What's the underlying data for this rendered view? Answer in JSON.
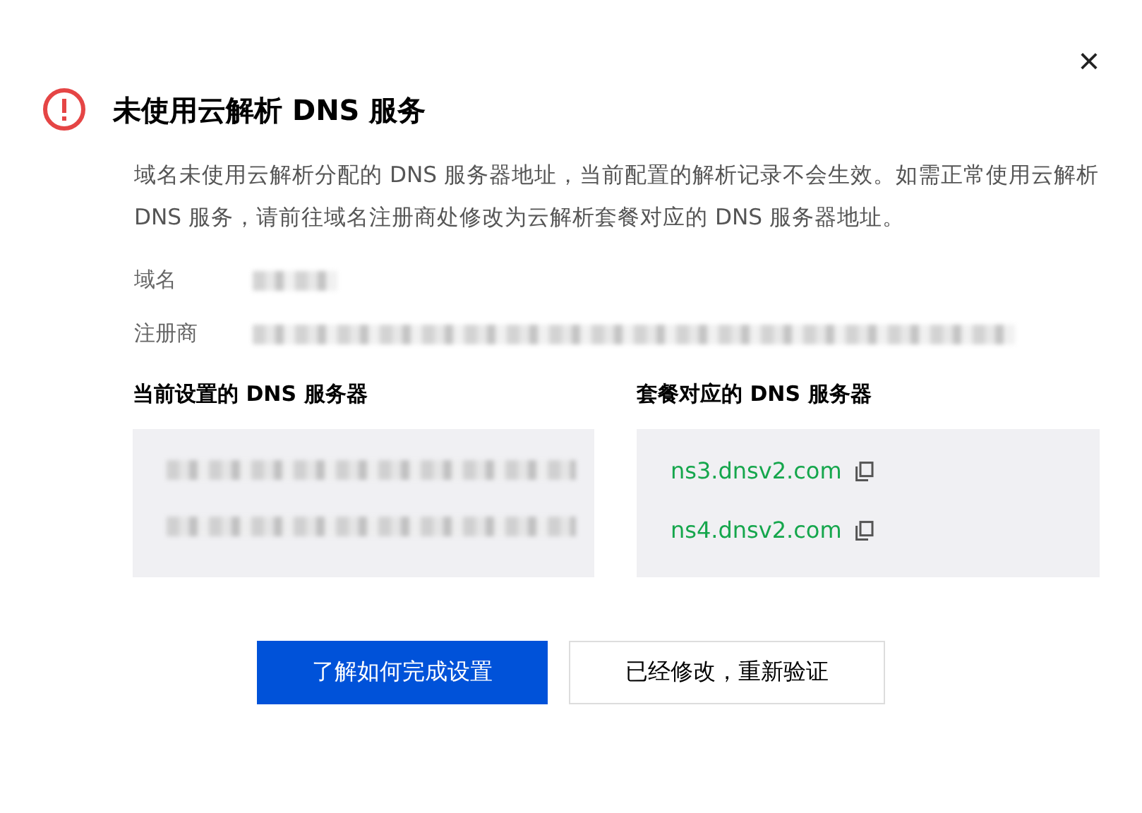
{
  "dialog": {
    "close": "×",
    "title": "未使用云解析 DNS 服务",
    "description": "域名未使用云解析分配的 DNS 服务器地址，当前配置的解析记录不会生效。如需正常使用云解析 DNS 服务，请前往域名注册商处修改为云解析套餐对应的 DNS 服务器地址。",
    "fields": [
      {
        "label": "域名"
      },
      {
        "label": "注册商"
      }
    ],
    "current_servers": {
      "heading": "当前设置的 DNS 服务器"
    },
    "package_servers": {
      "heading": "套餐对应的 DNS 服务器",
      "servers": [
        "ns3.dnsv2.com",
        "ns4.dnsv2.com"
      ]
    },
    "buttons": [
      {
        "label": "了解如何完成设置",
        "kind": "primary"
      },
      {
        "label": "已经修改，重新验证",
        "kind": "secondary"
      }
    ]
  }
}
